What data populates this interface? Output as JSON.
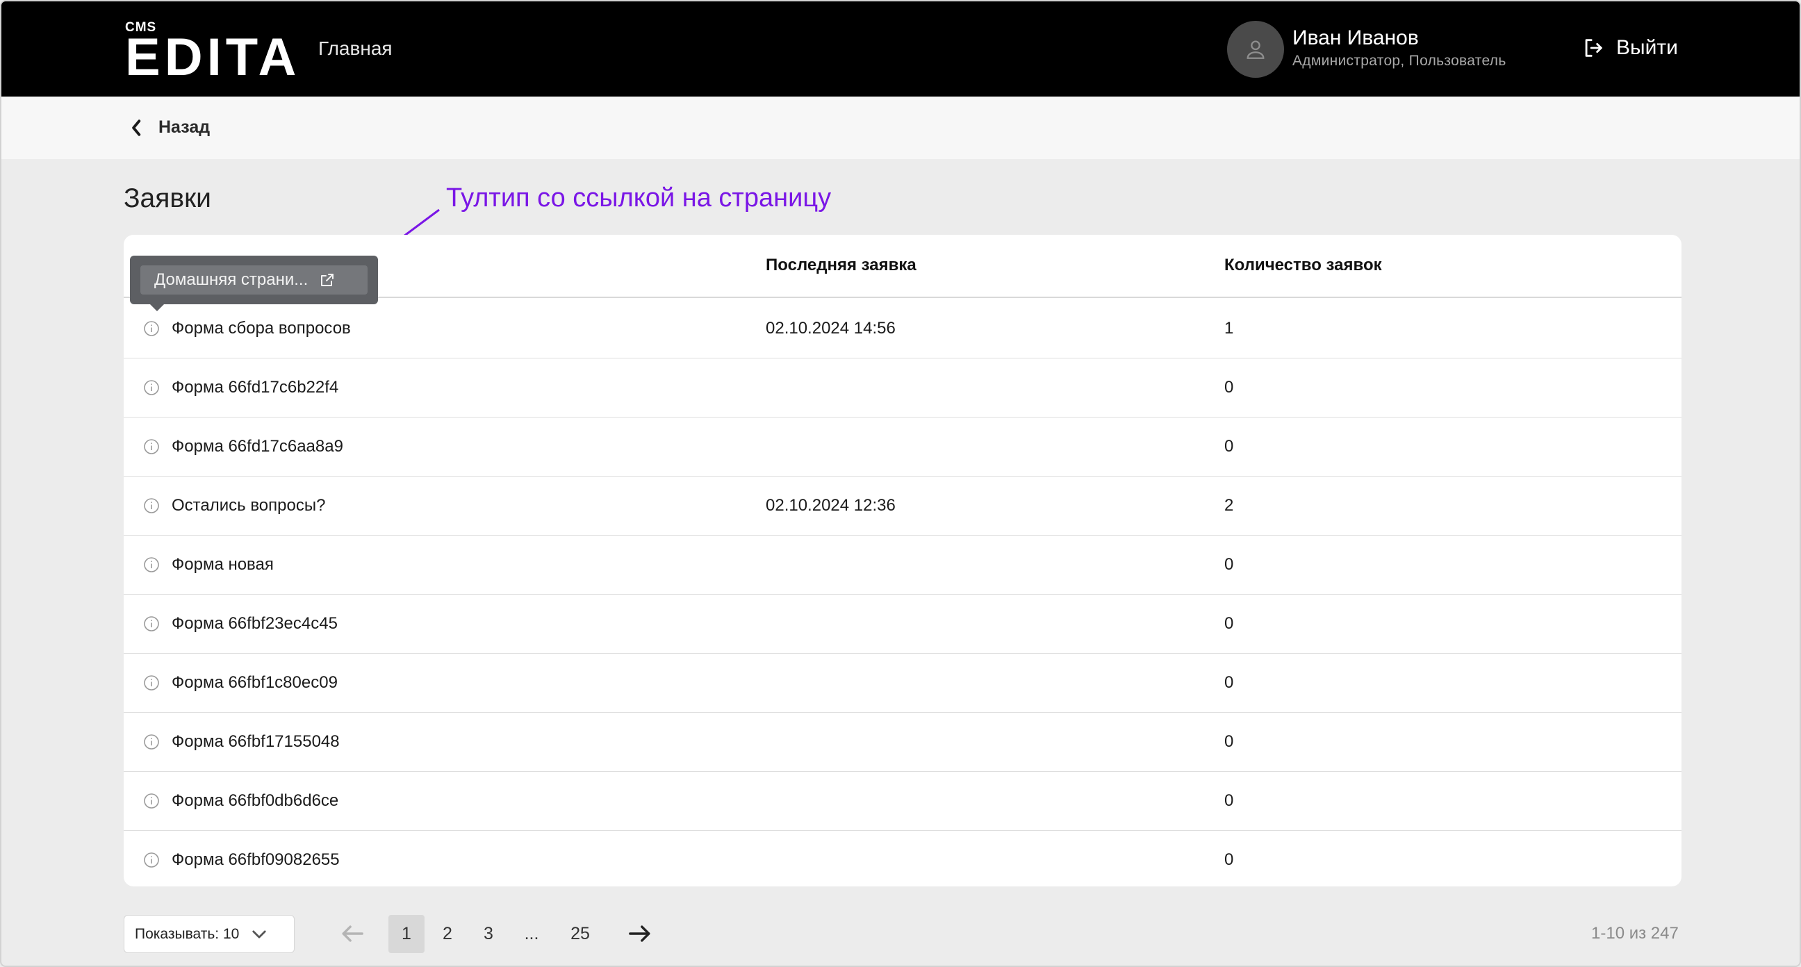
{
  "header": {
    "logo_small": "CMS",
    "logo_main": "EDITA",
    "nav_home": "Главная",
    "user_name": "Иван Иванов",
    "user_roles": "Администратор, Пользователь",
    "logout_label": "Выйти"
  },
  "backbar": {
    "back_label": "Назад"
  },
  "page": {
    "title": "Заявки"
  },
  "annotation": {
    "text": "Тултип со ссылкой на страницу",
    "color": "#7a16e6"
  },
  "tooltip": {
    "text": "Домашняя страни..."
  },
  "table": {
    "columns": [
      "",
      "Последняя заявка",
      "Количество заявок"
    ],
    "rows": [
      {
        "name": "Форма сбора вопросов",
        "last": "02.10.2024 14:56",
        "count": "1"
      },
      {
        "name": "Форма 66fd17c6b22f4",
        "last": "",
        "count": "0"
      },
      {
        "name": "Форма 66fd17c6aa8a9",
        "last": "",
        "count": "0"
      },
      {
        "name": "Остались вопросы?",
        "last": "02.10.2024 12:36",
        "count": "2"
      },
      {
        "name": "Форма новая",
        "last": "",
        "count": "0"
      },
      {
        "name": "Форма 66fbf23ec4c45",
        "last": "",
        "count": "0"
      },
      {
        "name": "Форма 66fbf1c80ec09",
        "last": "",
        "count": "0"
      },
      {
        "name": "Форма 66fbf17155048",
        "last": "",
        "count": "0"
      },
      {
        "name": "Форма 66fbf0db6d6ce",
        "last": "",
        "count": "0"
      },
      {
        "name": "Форма 66fbf09082655",
        "last": "",
        "count": "0"
      }
    ]
  },
  "pagination": {
    "page_size_label": "Показывать: 10",
    "pages": [
      "1",
      "2",
      "3",
      "...",
      "25"
    ],
    "current": "1",
    "range": "1-10 из 247"
  },
  "icons": {
    "row": "info-icon",
    "tooltip": "external-link-icon",
    "back": "chevron-left-icon",
    "logout": "logout-icon",
    "avatar": "user-icon",
    "dropdown": "chevron-down-icon",
    "prev": "arrow-left-icon",
    "next": "arrow-right-icon"
  },
  "colors": {
    "header_bg": "#000000",
    "accent": "#7a16e6",
    "tooltip_bg": "#5d5f63"
  }
}
